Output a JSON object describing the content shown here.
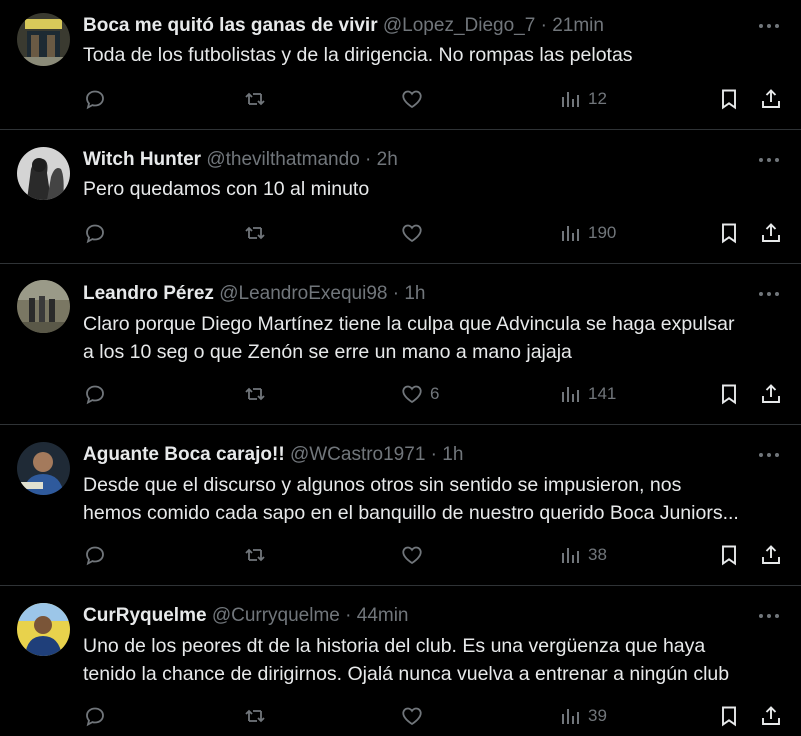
{
  "tweets": [
    {
      "name": "Boca me quitó las ganas de vivir",
      "handle": "@Lopez_Diego_7",
      "dot": "·",
      "time": "21min",
      "lines": [
        "Toda de los futbolistas y de la dirigencia. No rompas las pelotas"
      ],
      "likes": "",
      "views": "12",
      "avatar_color": "#5a5a4a"
    },
    {
      "name": "Witch Hunter",
      "handle": "@thevilthatmando",
      "dot": "·",
      "time": "2h",
      "lines": [
        "Pero quedamos con 10 al minuto"
      ],
      "likes": "",
      "views": "190",
      "avatar_color": "#cfcfcf"
    },
    {
      "name": "Leandro Pérez",
      "handle": "@LeandroExequi98",
      "dot": "·",
      "time": "1h",
      "lines": [
        "Claro porque Diego Martínez tiene la culpa que Advincula se haga expulsar",
        "a los 10 seg o que Zenón se erre un mano a mano jajaja"
      ],
      "likes": "6",
      "views": "141",
      "avatar_color": "#6b6a55"
    },
    {
      "name": "Aguante Boca carajo!!",
      "handle": "@WCastro1971",
      "dot": "·",
      "time": "1h",
      "lines": [
        "Desde que el discurso y algunos otros sin sentido se impusieron, nos",
        "hemos comido cada sapo en el banquillo de nuestro querido Boca Juniors..."
      ],
      "likes": "",
      "views": "38",
      "avatar_color": "#2c3e50"
    },
    {
      "name": "CurRyquelme",
      "handle": "@Curryquelme",
      "dot": "·",
      "time": "44min",
      "lines": [
        "Uno de los peores dt de la historia del club. Es una vergüenza que haya",
        "tenido la chance de dirigirnos. Ojalá nunca vuelva a entrenar a ningún club"
      ],
      "likes": "",
      "views": "39",
      "avatar_color": "#d9c34a"
    }
  ],
  "icons": {
    "reply": "reply-icon",
    "retweet": "retweet-icon",
    "like": "heart-icon",
    "views": "views-icon",
    "bookmark": "bookmark-icon",
    "share": "share-icon",
    "more": "more-icon"
  },
  "colors": {
    "background": "#000000",
    "text": "#e7e9ea",
    "secondary": "#71767b",
    "divider": "#2f3336"
  }
}
